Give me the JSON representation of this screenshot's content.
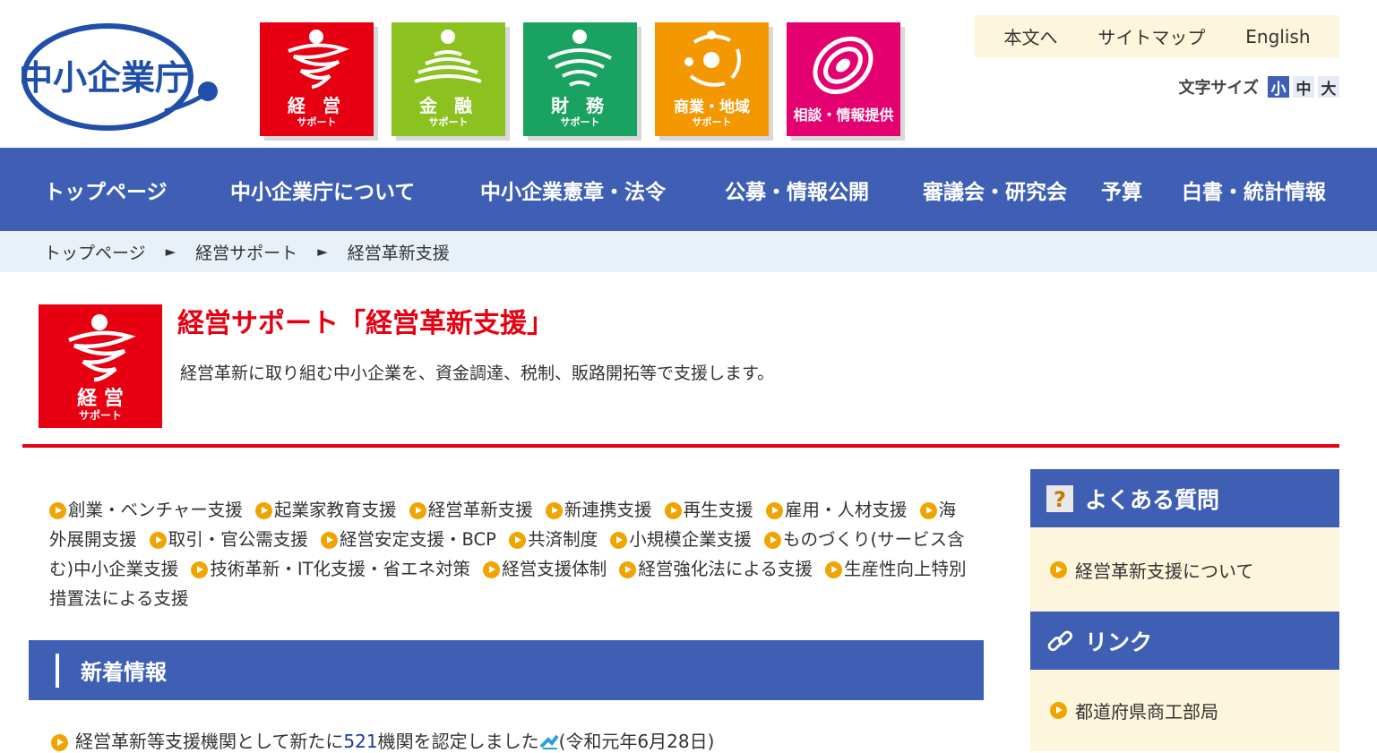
{
  "header": {
    "logo_text": "中小企業庁",
    "tiles": [
      {
        "title": "経 営",
        "sub": "サポート",
        "color": "#e60012",
        "icon": "management-icon"
      },
      {
        "title": "金 融",
        "sub": "サポート",
        "color": "#8cc220",
        "icon": "finance-icon"
      },
      {
        "title": "財 務",
        "sub": "サポート",
        "color": "#1aa261",
        "icon": "accounting-icon"
      },
      {
        "title": "商業・地域",
        "sub": "サポート",
        "color": "#f39800",
        "icon": "commerce-icon"
      },
      {
        "title": "相談・情報提供",
        "sub": "",
        "color": "#e4006e",
        "icon": "consultation-icon"
      }
    ],
    "toplinks": {
      "main": "本文へ",
      "sitemap": "サイトマップ",
      "english": "English"
    },
    "fontsize": {
      "label": "文字サイズ",
      "small": "小",
      "medium": "中",
      "large": "大",
      "active": "小"
    }
  },
  "nav": {
    "items": [
      "トップページ",
      "中小企業庁について",
      "中小企業憲章・法令",
      "公募・情報公開",
      "審議会・研究会",
      "予算",
      "白書・統計情報"
    ]
  },
  "breadcrumb": {
    "items": [
      "トップページ",
      "経営サポート",
      "経営革新支援"
    ],
    "separator": "►"
  },
  "hero": {
    "icon_title": "経 営",
    "icon_sub": "サポート",
    "title": "経営サポート「経営革新支援」",
    "description": "経営革新に取り組む中小企業を、資金調達、税制、販路開拓等で支援します。"
  },
  "categories": [
    "創業・ベンチャー支援",
    "起業家教育支援",
    "経営革新支援",
    "新連携支援",
    "再生支援",
    "雇用・人材支援",
    "海外展開支援",
    "取引・官公需支援",
    "経営安定支援・BCP",
    "共済制度",
    "小規模企業支援",
    "ものづくり(サービス含む)中小企業支援",
    "技術革新・IT化支援・省エネ対策",
    "経営支援体制",
    "経営強化法による支援",
    "生産性向上特別措置法による支援"
  ],
  "news": {
    "heading": "新着情報",
    "item_prefix": "経営革新等支援機関として新たに",
    "item_number": "521",
    "item_suffix": "機関を認定しました",
    "item_date": "(令和元年6月28日)"
  },
  "sidebar": {
    "faq_heading": "よくある質問",
    "faq_link": "経営革新支援について",
    "link_heading": "リンク",
    "link_item": "都道府県商工部局"
  },
  "colors": {
    "brand_blue": "#3e5fb4",
    "accent_red": "#e60012",
    "cream": "#fdf5dc",
    "bullet_orange": "#f0a400"
  }
}
